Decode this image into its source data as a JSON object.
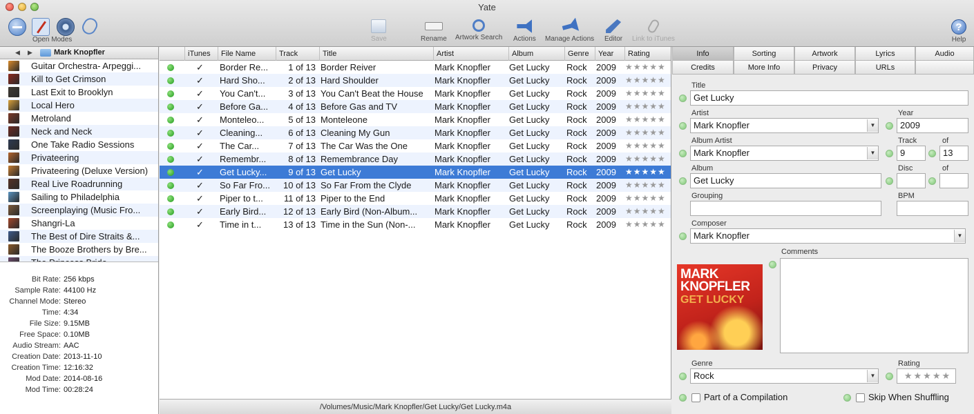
{
  "window": {
    "title": "Yate"
  },
  "toolbar": {
    "open_modes_label": "Open Modes",
    "buttons": [
      {
        "label": "Save",
        "icon": "save-icon",
        "enabled": false
      },
      {
        "label": "Rename",
        "icon": "rename-icon",
        "enabled": true
      },
      {
        "label": "Artwork Search",
        "icon": "magnifier-icon",
        "enabled": true
      },
      {
        "label": "Actions",
        "icon": "megaphone-icon",
        "enabled": true
      },
      {
        "label": "Manage Actions",
        "icon": "megaphone-gear-icon",
        "enabled": true
      },
      {
        "label": "Editor",
        "icon": "pencil-icon",
        "enabled": true
      },
      {
        "label": "Link to iTunes",
        "icon": "link-icon",
        "enabled": false
      }
    ],
    "help_label": "Help",
    "help_glyph": "?"
  },
  "browser": {
    "back_glyph": "◀",
    "forward_glyph": "▶",
    "breadcrumb": "Mark Knopfler",
    "albums": [
      {
        "name": "Guitar Orchestra- Arpeggi...",
        "color": "#d98b2b"
      },
      {
        "name": "Kill to Get Crimson",
        "color": "#8e2a1e"
      },
      {
        "name": "Last Exit to Brooklyn",
        "color": "#3f3a33"
      },
      {
        "name": "Local Hero",
        "color": "#d9a13b"
      },
      {
        "name": "Metroland",
        "color": "#7c3b2a"
      },
      {
        "name": "Neck and Neck",
        "color": "#6c2b22"
      },
      {
        "name": "One Take Radio Sessions",
        "color": "#2e3b52"
      },
      {
        "name": "Privateering",
        "color": "#b4642b"
      },
      {
        "name": "Privateering (Deluxe Version)",
        "color": "#c47c32"
      },
      {
        "name": "Real Live Roadrunning",
        "color": "#563226"
      },
      {
        "name": "Sailing to Philadelphia",
        "color": "#5a93bf"
      },
      {
        "name": "Screenplaying (Music Fro...",
        "color": "#7d5a3a"
      },
      {
        "name": "Shangri-La",
        "color": "#a4472b"
      },
      {
        "name": "The Best of Dire Straits &...",
        "color": "#3e5a8a"
      },
      {
        "name": "The Booze Brothers by Bre...",
        "color": "#8a5a2a"
      },
      {
        "name": "The Princess Bride",
        "color": "#6a4a6a"
      }
    ]
  },
  "properties": [
    {
      "key": "Bit Rate:",
      "value": "256 kbps"
    },
    {
      "key": "Sample Rate:",
      "value": "44100 Hz"
    },
    {
      "key": "Channel Mode:",
      "value": "Stereo"
    },
    {
      "key": "Time:",
      "value": "4:34"
    },
    {
      "key": "File Size:",
      "value": "9.15MB"
    },
    {
      "key": "Free Space:",
      "value": "0.10MB"
    },
    {
      "key": "Audio Stream:",
      "value": "AAC"
    },
    {
      "key": "Creation Date:",
      "value": "2013-11-10"
    },
    {
      "key": "Creation Time:",
      "value": "12:16:32"
    },
    {
      "key": "Mod Date:",
      "value": "2014-08-16"
    },
    {
      "key": "Mod Time:",
      "value": "00:28:24"
    }
  ],
  "track_table": {
    "columns": [
      "",
      "iTunes",
      "File Name",
      "Track",
      "Title",
      "Artist",
      "Album",
      "Genre",
      "Year",
      "Rating"
    ],
    "check_glyph": "✓",
    "rows": [
      {
        "file": "Border Re...",
        "track": "1 of 13",
        "title": "Border Reiver",
        "artist": "Mark Knopfler",
        "album": "Get Lucky",
        "genre": "Rock",
        "year": "2009",
        "rating": "★★★★★",
        "selected": false
      },
      {
        "file": "Hard Sho...",
        "track": "2 of 13",
        "title": "Hard Shoulder",
        "artist": "Mark Knopfler",
        "album": "Get Lucky",
        "genre": "Rock",
        "year": "2009",
        "rating": "★★★★★",
        "selected": false
      },
      {
        "file": "You Can't...",
        "track": "3 of 13",
        "title": "You Can't Beat the House",
        "artist": "Mark Knopfler",
        "album": "Get Lucky",
        "genre": "Rock",
        "year": "2009",
        "rating": "★★★★★",
        "selected": false
      },
      {
        "file": "Before Ga...",
        "track": "4 of 13",
        "title": "Before Gas and TV",
        "artist": "Mark Knopfler",
        "album": "Get Lucky",
        "genre": "Rock",
        "year": "2009",
        "rating": "★★★★★",
        "selected": false
      },
      {
        "file": "Monteleo...",
        "track": "5 of 13",
        "title": "Monteleone",
        "artist": "Mark Knopfler",
        "album": "Get Lucky",
        "genre": "Rock",
        "year": "2009",
        "rating": "★★★★★",
        "selected": false
      },
      {
        "file": "Cleaning...",
        "track": "6 of 13",
        "title": "Cleaning My Gun",
        "artist": "Mark Knopfler",
        "album": "Get Lucky",
        "genre": "Rock",
        "year": "2009",
        "rating": "★★★★★",
        "selected": false
      },
      {
        "file": "The Car...",
        "track": "7 of 13",
        "title": "The Car Was the One",
        "artist": "Mark Knopfler",
        "album": "Get Lucky",
        "genre": "Rock",
        "year": "2009",
        "rating": "★★★★★",
        "selected": false
      },
      {
        "file": "Remembr...",
        "track": "8 of 13",
        "title": "Remembrance Day",
        "artist": "Mark Knopfler",
        "album": "Get Lucky",
        "genre": "Rock",
        "year": "2009",
        "rating": "★★★★★",
        "selected": false
      },
      {
        "file": "Get Lucky...",
        "track": "9 of 13",
        "title": "Get Lucky",
        "artist": "Mark Knopfler",
        "album": "Get Lucky",
        "genre": "Rock",
        "year": "2009",
        "rating": "★★★★★",
        "selected": true
      },
      {
        "file": "So Far Fro...",
        "track": "10 of 13",
        "title": "So Far From the Clyde",
        "artist": "Mark Knopfler",
        "album": "Get Lucky",
        "genre": "Rock",
        "year": "2009",
        "rating": "★★★★★",
        "selected": false
      },
      {
        "file": "Piper to t...",
        "track": "11 of 13",
        "title": "Piper to the End",
        "artist": "Mark Knopfler",
        "album": "Get Lucky",
        "genre": "Rock",
        "year": "2009",
        "rating": "★★★★★",
        "selected": false
      },
      {
        "file": "Early Bird...",
        "track": "12 of 13",
        "title": "Early Bird (Non-Album...",
        "artist": "Mark Knopfler",
        "album": "Get Lucky",
        "genre": "Rock",
        "year": "2009",
        "rating": "★★★★★",
        "selected": false
      },
      {
        "file": "Time in t...",
        "track": "13 of 13",
        "title": "Time in the Sun (Non-...",
        "artist": "Mark Knopfler",
        "album": "Get Lucky",
        "genre": "Rock",
        "year": "2009",
        "rating": "★★★★★",
        "selected": false
      }
    ]
  },
  "path_bar": "/Volumes/Music/Mark Knopfler/Get Lucky/Get Lucky.m4a",
  "editor": {
    "tabs_row1": [
      "Info",
      "Sorting",
      "Artwork",
      "Lyrics",
      "Audio"
    ],
    "tabs_row2": [
      "Credits",
      "More Info",
      "Privacy",
      "URLs",
      ""
    ],
    "active_tab": "Info",
    "labels": {
      "title": "Title",
      "artist": "Artist",
      "year": "Year",
      "album_artist": "Album Artist",
      "track": "Track",
      "of": "of",
      "album": "Album",
      "disc": "Disc",
      "grouping": "Grouping",
      "bpm": "BPM",
      "composer": "Composer",
      "comments": "Comments",
      "genre": "Genre",
      "rating": "Rating",
      "compilation": "Part of a Compilation",
      "skip": "Skip When Shuffling"
    },
    "values": {
      "title": "Get Lucky",
      "artist": "Mark Knopfler",
      "year": "2009",
      "album_artist": "Mark Knopfler",
      "track": "9",
      "track_total": "13",
      "album": "Get Lucky",
      "disc": "",
      "disc_total": "",
      "grouping": "",
      "bpm": "",
      "composer": "Mark Knopfler",
      "comments": "",
      "genre": "Rock",
      "rating": "★★★★★"
    },
    "combo_glyph": "▼",
    "artwork_text_top": "MARK KNOPFLER",
    "artwork_text_bottom": "GET LUCKY"
  }
}
